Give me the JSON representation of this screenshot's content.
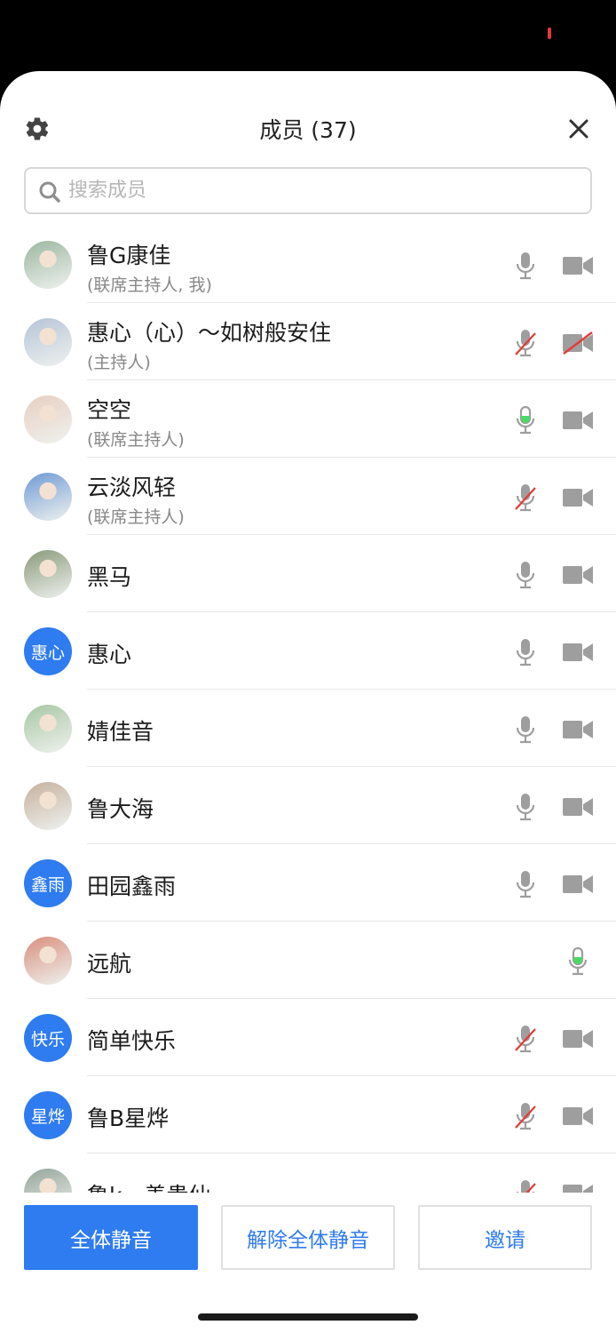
{
  "header": {
    "title": "成员 (37)",
    "settings_icon": "gear-icon",
    "close_icon": "close-icon"
  },
  "search": {
    "placeholder": "搜索成员",
    "value": ""
  },
  "members": [
    {
      "name": "鲁G康佳",
      "role": "(联席主持人, 我)",
      "avatar_type": "photo",
      "mic": "on",
      "camera": "on"
    },
    {
      "name": "惠心（心）～如树般安住",
      "role": "(主持人)",
      "avatar_type": "photo",
      "mic": "muted",
      "camera": "off"
    },
    {
      "name": "空空",
      "role": "(联席主持人)",
      "avatar_type": "photo",
      "mic": "speaking",
      "camera": "on"
    },
    {
      "name": "云淡风轻",
      "role": "(联席主持人)",
      "avatar_type": "photo",
      "mic": "muted",
      "camera": "on"
    },
    {
      "name": "黑马",
      "role": "",
      "avatar_type": "photo",
      "mic": "on",
      "camera": "on"
    },
    {
      "name": "惠心",
      "role": "",
      "avatar_type": "text",
      "avatar_text": "惠心",
      "mic": "on",
      "camera": "on"
    },
    {
      "name": "婧佳音",
      "role": "",
      "avatar_type": "photo",
      "mic": "on",
      "camera": "on"
    },
    {
      "name": "鲁大海",
      "role": "",
      "avatar_type": "photo",
      "mic": "on",
      "camera": "on"
    },
    {
      "name": "田园鑫雨",
      "role": "",
      "avatar_type": "text",
      "avatar_text": "鑫雨",
      "mic": "on",
      "camera": "on"
    },
    {
      "name": "远航",
      "role": "",
      "avatar_type": "photo",
      "mic": "speaking",
      "camera": "none"
    },
    {
      "name": "简单快乐",
      "role": "",
      "avatar_type": "text",
      "avatar_text": "快乐",
      "mic": "muted",
      "camera": "on"
    },
    {
      "name": "鲁B星烨",
      "role": "",
      "avatar_type": "text",
      "avatar_text": "星烨",
      "mic": "muted",
      "camera": "on"
    },
    {
      "name": "鲁k一善贵仙",
      "role": "",
      "avatar_type": "photo",
      "mic": "muted",
      "camera": "on"
    }
  ],
  "footer": {
    "mute_all_label": "全体静音",
    "unmute_all_label": "解除全体静音",
    "invite_label": "邀请"
  },
  "colors": {
    "accent": "#2f7bf0",
    "speaking": "#4cd964",
    "muted_slash": "#e53935",
    "icon_gray": "#9e9e9e"
  }
}
